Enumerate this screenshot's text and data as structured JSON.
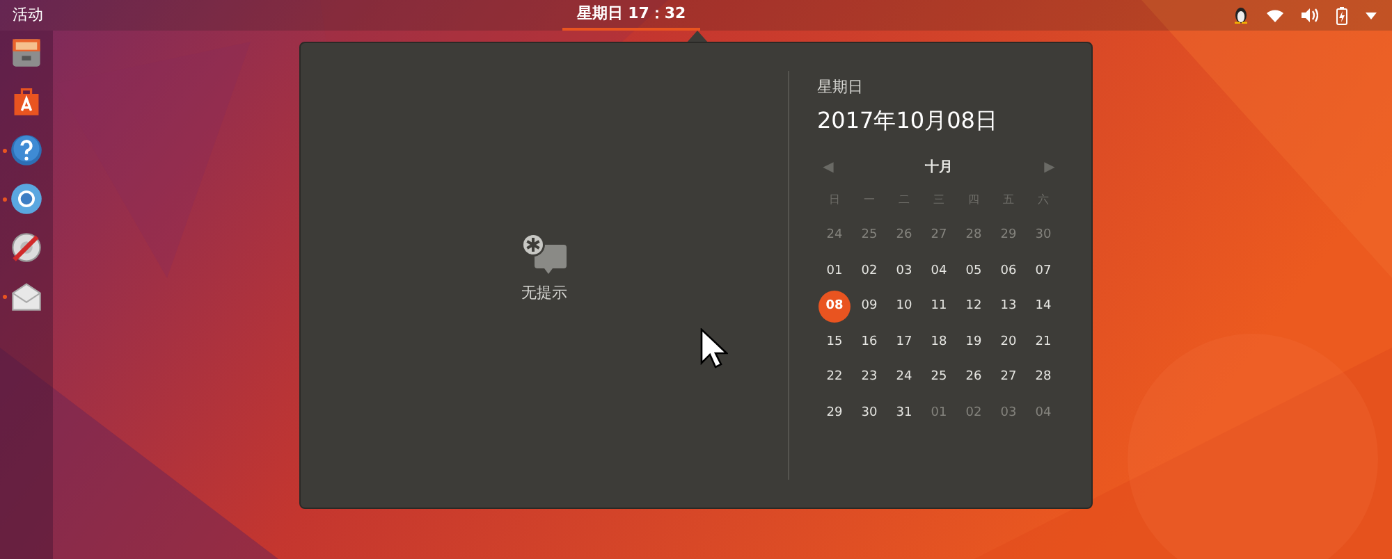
{
  "top_bar": {
    "activities": "活动",
    "clock": {
      "label": "星期日 17：32",
      "selected": true
    }
  },
  "dock": {
    "items": [
      {
        "kind": "files",
        "running": false
      },
      {
        "kind": "store",
        "running": false
      },
      {
        "kind": "help",
        "running": true
      },
      {
        "kind": "browser",
        "running": true
      },
      {
        "kind": "settings",
        "running": false
      },
      {
        "kind": "mail",
        "running": true
      }
    ]
  },
  "notifications": {
    "empty_label": "无提示"
  },
  "calendar": {
    "weekday": "星期日",
    "date": "2017年10月08日",
    "month": "十月",
    "prev": "◀",
    "next": "▶",
    "weekdays": [
      "日",
      "一",
      "二",
      "三",
      "四",
      "五",
      "六"
    ],
    "weeks": [
      [
        {
          "day": "24",
          "outside": true,
          "selected": false
        },
        {
          "day": "25",
          "outside": true,
          "selected": false
        },
        {
          "day": "26",
          "outside": true,
          "selected": false
        },
        {
          "day": "27",
          "outside": true,
          "selected": false
        },
        {
          "day": "28",
          "outside": true,
          "selected": false
        },
        {
          "day": "29",
          "outside": true,
          "selected": false
        },
        {
          "day": "30",
          "outside": true,
          "selected": false
        }
      ],
      [
        {
          "day": "01",
          "outside": false,
          "selected": false
        },
        {
          "day": "02",
          "outside": false,
          "selected": false
        },
        {
          "day": "03",
          "outside": false,
          "selected": false
        },
        {
          "day": "04",
          "outside": false,
          "selected": false
        },
        {
          "day": "05",
          "outside": false,
          "selected": false
        },
        {
          "day": "06",
          "outside": false,
          "selected": false
        },
        {
          "day": "07",
          "outside": false,
          "selected": false
        }
      ],
      [
        {
          "day": "08",
          "outside": false,
          "selected": true
        },
        {
          "day": "09",
          "outside": false,
          "selected": false
        },
        {
          "day": "10",
          "outside": false,
          "selected": false
        },
        {
          "day": "11",
          "outside": false,
          "selected": false
        },
        {
          "day": "12",
          "outside": false,
          "selected": false
        },
        {
          "day": "13",
          "outside": false,
          "selected": false
        },
        {
          "day": "14",
          "outside": false,
          "selected": false
        }
      ],
      [
        {
          "day": "15",
          "outside": false,
          "selected": false
        },
        {
          "day": "16",
          "outside": false,
          "selected": false
        },
        {
          "day": "17",
          "outside": false,
          "selected": false
        },
        {
          "day": "18",
          "outside": false,
          "selected": false
        },
        {
          "day": "19",
          "outside": false,
          "selected": false
        },
        {
          "day": "20",
          "outside": false,
          "selected": false
        },
        {
          "day": "21",
          "outside": false,
          "selected": false
        }
      ],
      [
        {
          "day": "22",
          "outside": false,
          "selected": false
        },
        {
          "day": "23",
          "outside": false,
          "selected": false
        },
        {
          "day": "24",
          "outside": false,
          "selected": false
        },
        {
          "day": "25",
          "outside": false,
          "selected": false
        },
        {
          "day": "26",
          "outside": false,
          "selected": false
        },
        {
          "day": "27",
          "outside": false,
          "selected": false
        },
        {
          "day": "28",
          "outside": false,
          "selected": false
        }
      ],
      [
        {
          "day": "29",
          "outside": false,
          "selected": false
        },
        {
          "day": "30",
          "outside": false,
          "selected": false
        },
        {
          "day": "31",
          "outside": false,
          "selected": false
        },
        {
          "day": "01",
          "outside": true,
          "selected": false
        },
        {
          "day": "02",
          "outside": true,
          "selected": false
        },
        {
          "day": "03",
          "outside": true,
          "selected": false
        },
        {
          "day": "04",
          "outside": true,
          "selected": false
        }
      ]
    ]
  }
}
